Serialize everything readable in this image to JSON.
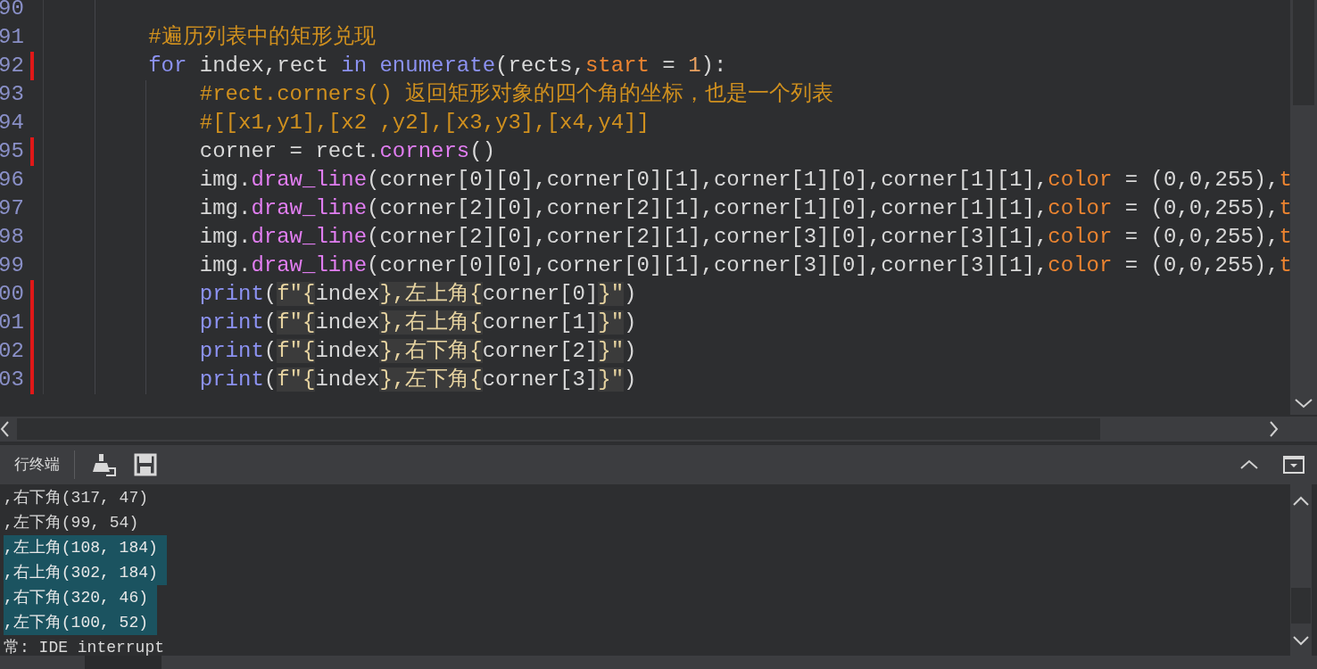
{
  "editor": {
    "lines": [
      {
        "number": "90",
        "modified": false
      },
      {
        "number": "91",
        "modified": false,
        "tokens": [
          {
            "kind": "comment",
            "text": "#遍历列表中的矩形兑现"
          }
        ]
      },
      {
        "number": "92",
        "modified": true,
        "tokens": [
          {
            "kind": "keyword",
            "text": "for"
          },
          {
            "kind": "plain",
            "text": " index,rect "
          },
          {
            "kind": "keyword",
            "text": "in enumerate"
          },
          {
            "kind": "plain",
            "text": "(rects,"
          },
          {
            "kind": "param",
            "text": "start"
          },
          {
            "kind": "plain",
            "text": " = "
          },
          {
            "kind": "number",
            "text": "1"
          },
          {
            "kind": "plain",
            "text": "):"
          }
        ],
        "children": [
          {
            "number": "93",
            "modified": false,
            "tokens": [
              {
                "kind": "comment",
                "text": "#rect.corners() 返回矩形对象的四个角的坐标，也是一个列表"
              }
            ]
          },
          {
            "number": "94",
            "modified": false,
            "tokens": [
              {
                "kind": "comment",
                "text": "#[[x1,y1],[x2 ,y2],[x3,y3],[x4,y4]]"
              }
            ]
          },
          {
            "number": "95",
            "modified": true,
            "tokens": [
              {
                "kind": "plain",
                "text": "corner = rect."
              },
              {
                "kind": "method",
                "text": "corners"
              },
              {
                "kind": "plain",
                "text": "()"
              }
            ]
          },
          {
            "number": "96",
            "modified": false,
            "tokens": [
              {
                "kind": "plain",
                "text": "img."
              },
              {
                "kind": "method",
                "text": "draw_line"
              },
              {
                "kind": "plain",
                "text": "(corner[0][0],corner[0][1],corner[1][0],corner[1][1],"
              },
              {
                "kind": "param",
                "text": "color"
              },
              {
                "kind": "plain",
                "text": " = (0,0,255),"
              },
              {
                "kind": "param",
                "text": "t"
              }
            ]
          },
          {
            "number": "97",
            "modified": false,
            "tokens": [
              {
                "kind": "plain",
                "text": "img."
              },
              {
                "kind": "method",
                "text": "draw_line"
              },
              {
                "kind": "plain",
                "text": "(corner[2][0],corner[2][1],corner[1][0],corner[1][1],"
              },
              {
                "kind": "param",
                "text": "color"
              },
              {
                "kind": "plain",
                "text": " = (0,0,255),"
              },
              {
                "kind": "param",
                "text": "t"
              }
            ]
          },
          {
            "number": "98",
            "modified": false,
            "tokens": [
              {
                "kind": "plain",
                "text": "img."
              },
              {
                "kind": "method",
                "text": "draw_line"
              },
              {
                "kind": "plain",
                "text": "(corner[2][0],corner[2][1],corner[3][0],corner[3][1],"
              },
              {
                "kind": "param",
                "text": "color"
              },
              {
                "kind": "plain",
                "text": " = (0,0,255),"
              },
              {
                "kind": "param",
                "text": "t"
              }
            ]
          },
          {
            "number": "99",
            "modified": false,
            "tokens": [
              {
                "kind": "plain",
                "text": "img."
              },
              {
                "kind": "method",
                "text": "draw_line"
              },
              {
                "kind": "plain",
                "text": "(corner[0][0],corner[0][1],corner[3][0],corner[3][1],"
              },
              {
                "kind": "param",
                "text": "color"
              },
              {
                "kind": "plain",
                "text": " = (0,0,255),"
              },
              {
                "kind": "param",
                "text": "t"
              }
            ]
          },
          {
            "number": "00",
            "modified": true,
            "tokens": [
              {
                "kind": "keyword",
                "text": "print"
              },
              {
                "kind": "plain",
                "text": "("
              },
              {
                "kind": "fstring",
                "text": "f\"{"
              },
              {
                "kind": "plain",
                "text": "index"
              },
              {
                "kind": "fstring",
                "text": "},左上角{"
              },
              {
                "kind": "plain",
                "text": "corner[0]"
              },
              {
                "kind": "fstring",
                "text": "}\""
              },
              {
                "kind": "plain",
                "text": ")"
              }
            ]
          },
          {
            "number": "01",
            "modified": true,
            "tokens": [
              {
                "kind": "keyword",
                "text": "print"
              },
              {
                "kind": "plain",
                "text": "("
              },
              {
                "kind": "fstring",
                "text": "f\"{"
              },
              {
                "kind": "plain",
                "text": "index"
              },
              {
                "kind": "fstring",
                "text": "},右上角{"
              },
              {
                "kind": "plain",
                "text": "corner[1]"
              },
              {
                "kind": "fstring",
                "text": "}\""
              },
              {
                "kind": "plain",
                "text": ")"
              }
            ]
          },
          {
            "number": "02",
            "modified": true,
            "tokens": [
              {
                "kind": "keyword",
                "text": "print"
              },
              {
                "kind": "plain",
                "text": "("
              },
              {
                "kind": "fstring",
                "text": "f\"{"
              },
              {
                "kind": "plain",
                "text": "index"
              },
              {
                "kind": "fstring",
                "text": "},右下角{"
              },
              {
                "kind": "plain",
                "text": "corner[2]"
              },
              {
                "kind": "fstring",
                "text": "}\""
              },
              {
                "kind": "plain",
                "text": ")"
              }
            ]
          },
          {
            "number": "03",
            "modified": true,
            "tokens": [
              {
                "kind": "keyword",
                "text": "print"
              },
              {
                "kind": "plain",
                "text": "("
              },
              {
                "kind": "fstring",
                "text": "f\"{"
              },
              {
                "kind": "plain",
                "text": "index"
              },
              {
                "kind": "fstring",
                "text": "},左下角{"
              },
              {
                "kind": "plain",
                "text": "corner[3]"
              },
              {
                "kind": "fstring",
                "text": "}\""
              },
              {
                "kind": "plain",
                "text": ")"
              }
            ]
          }
        ]
      }
    ]
  },
  "terminal": {
    "title": "行终端",
    "lines": [
      {
        "text": ",右下角(317, 47)",
        "selected": false
      },
      {
        "text": ",左下角(99, 54)",
        "selected": false
      },
      {
        "text": ",左上角(108, 184)",
        "selected": true
      },
      {
        "text": ",右上角(302, 184)",
        "selected": true
      },
      {
        "text": ",右下角(320, 46)",
        "selected": true
      },
      {
        "text": ",左下角(100, 52)",
        "selected": true
      },
      {
        "text": "常: IDE interrupt",
        "selected": false
      }
    ]
  }
}
